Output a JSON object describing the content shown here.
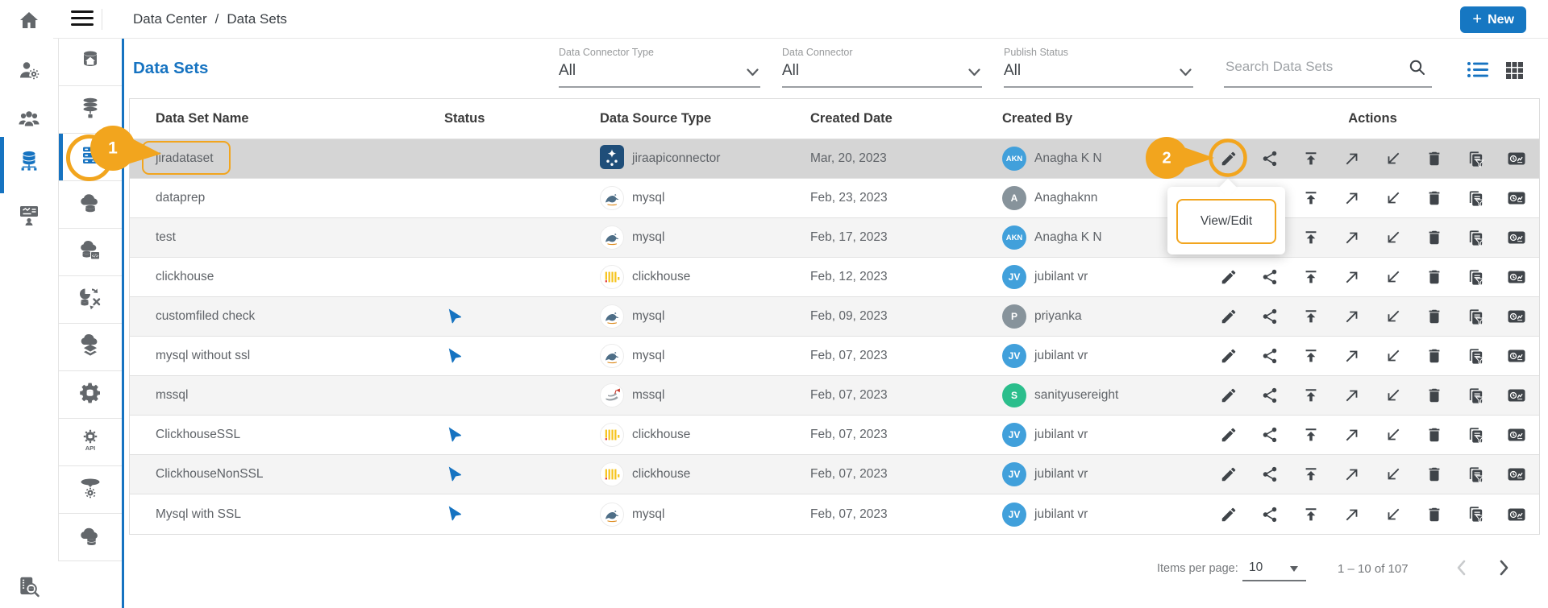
{
  "topbar": {
    "breadcrumb": {
      "items": [
        "Data Center",
        "Data Sets"
      ],
      "separator": "/"
    },
    "new_plus": "+",
    "new_label": "New"
  },
  "page": {
    "title": "Data Sets"
  },
  "filters": [
    {
      "label": "Data Connector Type",
      "value": "All"
    },
    {
      "label": "Data Connector",
      "value": "All"
    },
    {
      "label": "Publish Status",
      "value": "All"
    }
  ],
  "search": {
    "placeholder": "Search Data Sets"
  },
  "view_toggles": [
    "list-view-icon",
    "grid-view-icon"
  ],
  "table": {
    "columns": [
      "Data Set Name",
      "Status",
      "Data Source Type",
      "Created Date",
      "Created By",
      "Actions"
    ],
    "rows": [
      {
        "name": "jiradataset",
        "published": false,
        "source": {
          "type": "jira",
          "label": "jiraapiconnector"
        },
        "created": "Mar, 20, 2023",
        "by": {
          "name": "Anagha K N",
          "initials": "AKN",
          "color": "#41A0DB"
        },
        "selected": true
      },
      {
        "name": "dataprep",
        "published": false,
        "source": {
          "type": "mysql",
          "label": "mysql"
        },
        "created": "Feb, 23, 2023",
        "by": {
          "name": "Anaghaknn",
          "initials": "A",
          "color": "#87939B"
        }
      },
      {
        "name": "test",
        "published": false,
        "source": {
          "type": "mysql",
          "label": "mysql"
        },
        "created": "Feb, 17, 2023",
        "by": {
          "name": "Anagha K N",
          "initials": "AKN",
          "color": "#41A0DB"
        }
      },
      {
        "name": "clickhouse",
        "published": false,
        "source": {
          "type": "clickhouse",
          "label": "clickhouse"
        },
        "created": "Feb, 12, 2023",
        "by": {
          "name": "jubilant vr",
          "initials": "JV",
          "color": "#41A0DB"
        }
      },
      {
        "name": "customfiled check",
        "published": true,
        "source": {
          "type": "mysql",
          "label": "mysql"
        },
        "created": "Feb, 09, 2023",
        "by": {
          "name": "priyanka",
          "initials": "P",
          "color": "#87939B"
        }
      },
      {
        "name": "mysql without ssl",
        "published": true,
        "source": {
          "type": "mysql",
          "label": "mysql"
        },
        "created": "Feb, 07, 2023",
        "by": {
          "name": "jubilant vr",
          "initials": "JV",
          "color": "#41A0DB"
        }
      },
      {
        "name": "mssql",
        "published": false,
        "source": {
          "type": "mssql",
          "label": "mssql"
        },
        "created": "Feb, 07, 2023",
        "by": {
          "name": "sanityusereight",
          "initials": "S",
          "color": "#2BBE8C"
        }
      },
      {
        "name": "ClickhouseSSL",
        "published": true,
        "source": {
          "type": "clickhouse",
          "label": "clickhouse"
        },
        "created": "Feb, 07, 2023",
        "by": {
          "name": "jubilant vr",
          "initials": "JV",
          "color": "#41A0DB"
        }
      },
      {
        "name": "ClickhouseNonSSL",
        "published": true,
        "source": {
          "type": "clickhouse",
          "label": "clickhouse"
        },
        "created": "Feb, 07, 2023",
        "by": {
          "name": "jubilant vr",
          "initials": "JV",
          "color": "#41A0DB"
        }
      },
      {
        "name": "Mysql with SSL",
        "published": true,
        "source": {
          "type": "mysql",
          "label": "mysql"
        },
        "created": "Feb, 07, 2023",
        "by": {
          "name": "jubilant vr",
          "initials": "JV",
          "color": "#41A0DB"
        }
      }
    ]
  },
  "actions": [
    {
      "icon": "edit-icon"
    },
    {
      "icon": "share-icon"
    },
    {
      "icon": "publish-upload-icon"
    },
    {
      "icon": "open-northeast-icon"
    },
    {
      "icon": "import-southwest-icon"
    },
    {
      "icon": "delete-icon"
    },
    {
      "icon": "copy-filter-icon"
    },
    {
      "icon": "usage-stats-icon"
    }
  ],
  "sidebar": {
    "rail1": [
      {
        "icon": "home-icon"
      },
      {
        "icon": "user-settings-icon"
      },
      {
        "icon": "user-groups-icon"
      },
      {
        "icon": "data-center-icon",
        "active": true
      },
      {
        "icon": "presentation-board-icon"
      }
    ],
    "rail1_bottom": {
      "icon": "data-catalog-search-icon"
    },
    "rail2": [
      {
        "icon": "database-home-icon"
      },
      {
        "icon": "database-stack-icon"
      },
      {
        "icon": "datasets-server-icon",
        "active": true
      },
      {
        "icon": "cloud-database-icon"
      },
      {
        "icon": "cloud-database-code-icon"
      },
      {
        "icon": "data-flow-pie-icon"
      },
      {
        "icon": "cloud-layers-icon"
      },
      {
        "icon": "data-engine-gear-icon"
      },
      {
        "icon": "api-gear-icon"
      },
      {
        "icon": "data-funnel-icon"
      },
      {
        "icon": "cloud-dataset-icon"
      }
    ]
  },
  "annotations": {
    "step1": "1",
    "step2": "2",
    "tooltip": "View/Edit"
  },
  "pagination": {
    "items_per_page_label": "Items per page:",
    "items_per_page": "10",
    "range": "1 – 10 of 107"
  },
  "colors": {
    "primary_blue": "#1673C1",
    "button_blue": "#1677C2",
    "annotation_orange": "#F2A51E",
    "selected_row": "#D5D5D5",
    "alt_row": "#F4F4F4",
    "flag_blue": "#1673C1",
    "avatar_blue": "#41A0DB",
    "avatar_gray": "#87939B",
    "avatar_green": "#2BBE8C"
  }
}
